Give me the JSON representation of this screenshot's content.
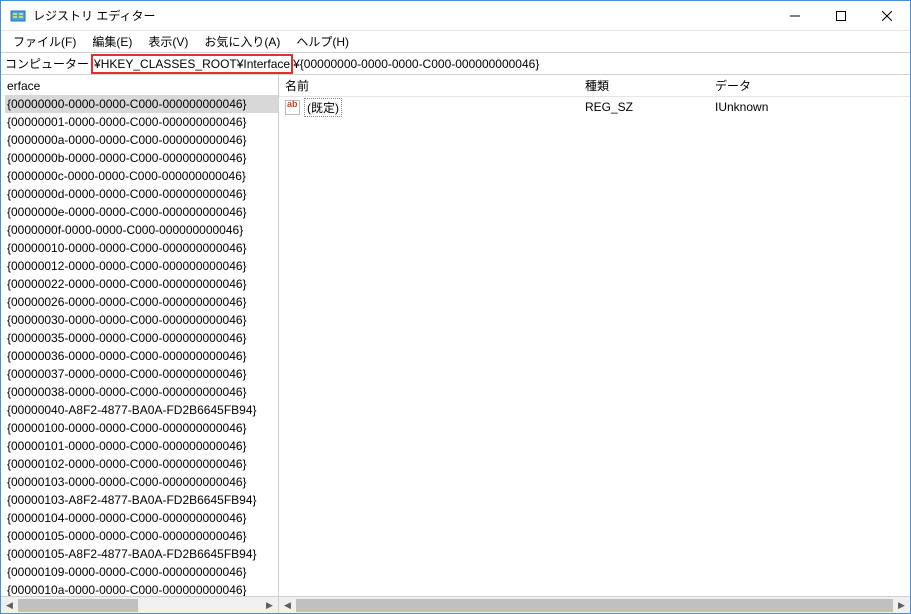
{
  "window": {
    "title": "レジストリ エディター"
  },
  "menu": {
    "file": "ファイル(F)",
    "edit": "編集(E)",
    "view": "表示(V)",
    "favorites": "お気に入り(A)",
    "help": "ヘルプ(H)"
  },
  "address": {
    "label": "コンピューター",
    "highlighted": "¥HKEY_CLASSES_ROOT¥Interface",
    "rest": "¥{00000000-0000-0000-C000-000000000046}"
  },
  "tree": {
    "root": "erface",
    "items": [
      "{00000000-0000-0000-C000-000000000046}",
      "{00000001-0000-0000-C000-000000000046}",
      "{0000000a-0000-0000-C000-000000000046}",
      "{0000000b-0000-0000-C000-000000000046}",
      "{0000000c-0000-0000-C000-000000000046}",
      "{0000000d-0000-0000-C000-000000000046}",
      "{0000000e-0000-0000-C000-000000000046}",
      "{0000000f-0000-0000-C000-000000000046}",
      "{00000010-0000-0000-C000-000000000046}",
      "{00000012-0000-0000-C000-000000000046}",
      "{00000022-0000-0000-C000-000000000046}",
      "{00000026-0000-0000-C000-000000000046}",
      "{00000030-0000-0000-C000-000000000046}",
      "{00000035-0000-0000-C000-000000000046}",
      "{00000036-0000-0000-C000-000000000046}",
      "{00000037-0000-0000-C000-000000000046}",
      "{00000038-0000-0000-C000-000000000046}",
      "{00000040-A8F2-4877-BA0A-FD2B6645FB94}",
      "{00000100-0000-0000-C000-000000000046}",
      "{00000101-0000-0000-C000-000000000046}",
      "{00000102-0000-0000-C000-000000000046}",
      "{00000103-0000-0000-C000-000000000046}",
      "{00000103-A8F2-4877-BA0A-FD2B6645FB94}",
      "{00000104-0000-0000-C000-000000000046}",
      "{00000105-0000-0000-C000-000000000046}",
      "{00000105-A8F2-4877-BA0A-FD2B6645FB94}",
      "{00000109-0000-0000-C000-000000000046}",
      "{0000010a-0000-0000-C000-000000000046}"
    ],
    "selected_index": 0
  },
  "list": {
    "columns": {
      "name": "名前",
      "type": "種類",
      "data": "データ"
    },
    "rows": [
      {
        "name": "(既定)",
        "type": "REG_SZ",
        "data": "IUnknown"
      }
    ]
  }
}
